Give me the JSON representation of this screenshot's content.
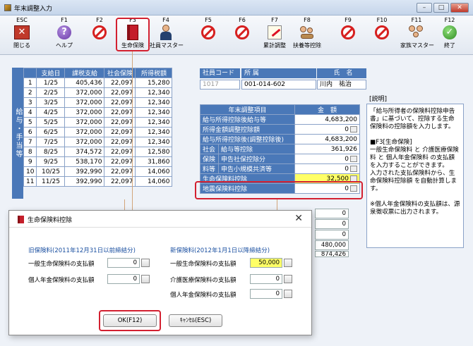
{
  "window": {
    "title": "年末調整入力"
  },
  "toolbar": [
    {
      "key": "ESC",
      "label": "閉じる",
      "icon": "exit-icon"
    },
    {
      "key": "F1",
      "label": "ヘルプ",
      "icon": "help-icon"
    },
    {
      "key": "F2",
      "label": "",
      "icon": "disabled-icon"
    },
    {
      "key": "F3",
      "label": "生命保険",
      "icon": "life-insurance-book-icon"
    },
    {
      "key": "F4",
      "label": "社員マスター",
      "icon": "employee-icon"
    },
    {
      "key": "F5",
      "label": "",
      "icon": "disabled-icon"
    },
    {
      "key": "F6",
      "label": "",
      "icon": "disabled-icon"
    },
    {
      "key": "F7",
      "label": "累計調整",
      "icon": "cumulative-adjust-icon"
    },
    {
      "key": "F8",
      "label": "扶養等控除",
      "icon": "dependents-icon"
    },
    {
      "key": "F9",
      "label": "",
      "icon": "disabled-icon"
    },
    {
      "key": "F10",
      "label": "",
      "icon": "disabled-icon"
    },
    {
      "key": "F11",
      "label": "家族マスター",
      "icon": "family-icon"
    },
    {
      "key": "F12",
      "label": "終了",
      "icon": "finish-icon"
    }
  ],
  "side_label": "給与・手当等",
  "payroll": {
    "headers": [
      "支給日",
      "課税支給",
      "社会保険",
      "所得税額"
    ],
    "rows": [
      {
        "no": "1",
        "date": "1/25",
        "taxable": "405,436",
        "social": "22,097",
        "tax": "15,280"
      },
      {
        "no": "2",
        "date": "2/25",
        "taxable": "372,000",
        "social": "22,097",
        "tax": "12,340"
      },
      {
        "no": "3",
        "date": "3/25",
        "taxable": "372,000",
        "social": "22,097",
        "tax": "12,340"
      },
      {
        "no": "4",
        "date": "4/25",
        "taxable": "372,000",
        "social": "22,097",
        "tax": "12,340"
      },
      {
        "no": "5",
        "date": "5/25",
        "taxable": "372,000",
        "social": "22,097",
        "tax": "12,340"
      },
      {
        "no": "6",
        "date": "6/25",
        "taxable": "372,000",
        "social": "22,097",
        "tax": "12,340"
      },
      {
        "no": "7",
        "date": "7/25",
        "taxable": "372,000",
        "social": "22,097",
        "tax": "12,340"
      },
      {
        "no": "8",
        "date": "8/25",
        "taxable": "374,572",
        "social": "22,097",
        "tax": "12,580"
      },
      {
        "no": "9",
        "date": "9/25",
        "taxable": "538,170",
        "social": "22,097",
        "tax": "31,860"
      },
      {
        "no": "10",
        "date": "10/25",
        "taxable": "392,990",
        "social": "22,097",
        "tax": "14,060"
      },
      {
        "no": "11",
        "date": "11/25",
        "taxable": "392,990",
        "social": "22,097",
        "tax": "14,060"
      }
    ]
  },
  "employee": {
    "code_label": "社員コード",
    "dept_label": "所 属",
    "name_label": "氏　名",
    "code_value": "1017",
    "dept_value": "001-014-602",
    "name_value": "川内　祐治"
  },
  "year_end": {
    "col_item": "年末調整項目",
    "col_amount": "金　額",
    "rows": [
      {
        "label": "給与所得控除後給与等",
        "value": "4,683,200"
      },
      {
        "label": "所得金額調整控除額",
        "value": "0"
      },
      {
        "label": "給与所得控除後(調整控除後)",
        "value": "4,683,200"
      },
      {
        "label": "給与等控除",
        "value": "361,926"
      },
      {
        "label": "申告社保控除分",
        "value": "0"
      },
      {
        "label": "申告小規模共済等",
        "value": "0"
      },
      {
        "label": "生命保険料控除",
        "value": "32,500"
      },
      {
        "label": "地震保険料控除",
        "value": "0"
      }
    ],
    "group_labels": [
      "社会",
      "保険",
      "料等"
    ],
    "extra_values": [
      "0",
      "0",
      "0",
      "480,000",
      "874,426"
    ]
  },
  "description": {
    "title": "[説明]",
    "text": "「給与所得者の保険料控除申告書」に基づいて、控除する生命保険料の控除額を入力します。\n\n■F3[生命保険]\n一般生命保険料 と 介護医療保険料 と 個人年金保険料 の支払額を入力することができます。\n入力された支払保険料から、生命保険料控除額 を自動計算します。\n\n※個人年金保険料の支払額は、源泉徴収票に出力されます。"
  },
  "dialog": {
    "title": "生命保険料控除",
    "old_group": "旧保険料(2011年12月31日以前締結分)",
    "new_group": "新保険料(2012年1月1日以降締結分)",
    "old_general_label": "一般生命保険料の支払額",
    "old_general_value": "0",
    "old_pension_label": "個人年金保険料の支払額",
    "old_pension_value": "0",
    "new_general_label": "一般生命保険料の支払額",
    "new_general_value": "50,000",
    "new_medical_label": "介護医療保険料の支払額",
    "new_medical_value": "0",
    "new_pension_label": "個人年金保険料の支払額",
    "new_pension_value": "0",
    "ok_label": "OK(F12)",
    "cancel_label": "ｷｬﾝｾﾙ(ESC)"
  },
  "colors": {
    "header_blue": "#4a78b8",
    "highlight_red": "#d32030",
    "input_yellow": "#ffff66"
  }
}
